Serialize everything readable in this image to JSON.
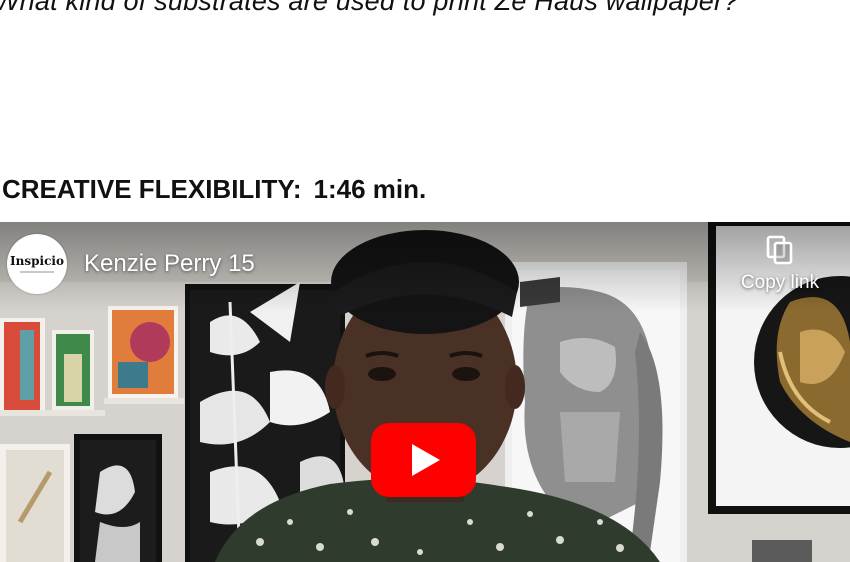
{
  "question": "What kind of substrates are used to print Ze Haus wallpaper?",
  "section": {
    "label": "CREATIVE FLEXIBILITY:",
    "duration": "1:46 min."
  },
  "video": {
    "channel_logo_text": "Inspicio",
    "title": "Kenzie Perry 15",
    "copy_link_label": "Copy link",
    "play_button_color": "#ff0000"
  }
}
